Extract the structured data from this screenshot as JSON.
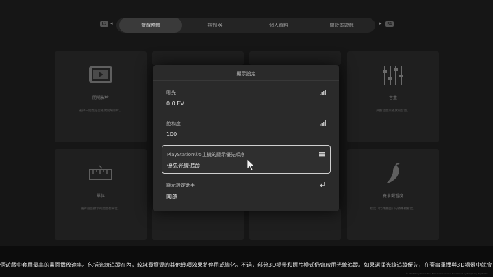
{
  "nav": {
    "left_hint": "L1",
    "right_hint": "R1",
    "tabs": [
      "遊戲整體",
      "控制器",
      "個人資料",
      "關於本遊戲"
    ],
    "active_tab_index": 0
  },
  "tiles": [
    {
      "title": "開場影片",
      "desc": "選擇一開始是否播放開場影片。",
      "icon": "film-icon"
    },
    {
      "title": "音量",
      "desc": "調整音量與播放的音量。",
      "icon": "sliders-icon"
    },
    {
      "title": "單位",
      "desc": "選擇遊戲顯示的度量衡單位。",
      "icon": "ruler-icon"
    },
    {
      "title": "賽事觀看度",
      "desc": "指定「比賽畫面」的賽事觀看度。",
      "icon": "chili-icon"
    }
  ],
  "dialog": {
    "title": "顯示設定",
    "rows": [
      {
        "label": "曝光",
        "value": "0.0 EV",
        "icon": "signal-bars-icon"
      },
      {
        "label": "飽和度",
        "value": "100",
        "icon": "signal-bars-icon"
      },
      {
        "label": "PlayStation®5主機的顯示優先順序",
        "value": "優先光線追蹤",
        "icon": "menu-icon"
      },
      {
        "label": "顯示設定助手",
        "value": "開啟",
        "icon": "enter-icon"
      }
    ],
    "selected_row_index": 2
  },
  "description": "個遊戲中套用最高的畫面播放速率。包括光線追蹤在內，較耗費資源的其他幾項效果將停用或簡化。不過，部分3D場景和照片模式仍會啟用光線追蹤。如果選擇光線追蹤優先，在賽事重播與3D場景中就會",
  "copyright": "© 2022 Sony Interactive Entertainment Inc. Developed by Polyphony Digital Inc."
}
